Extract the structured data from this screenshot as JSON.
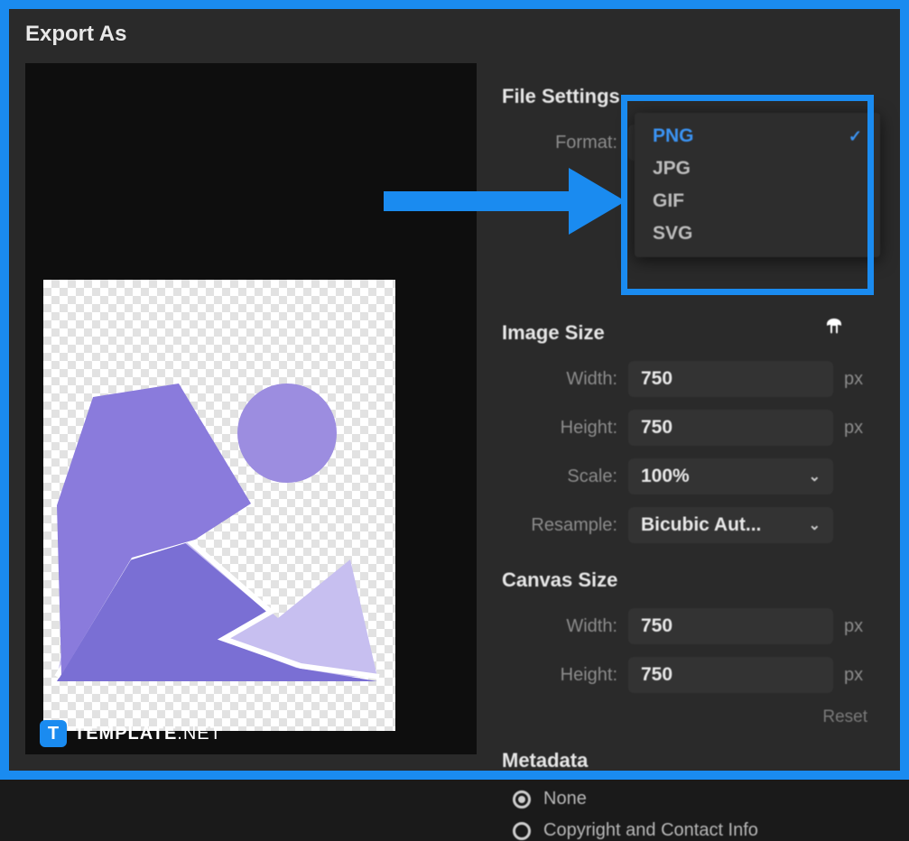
{
  "dialog": {
    "title": "Export As"
  },
  "fileSettings": {
    "header": "File Settings",
    "formatLabel": "Format:",
    "formatValue": "PNG",
    "options": [
      "PNG",
      "JPG",
      "GIF",
      "SVG"
    ]
  },
  "imageSize": {
    "header": "Image Size",
    "widthLabel": "Width:",
    "widthValue": "750",
    "heightLabel": "Height:",
    "heightValue": "750",
    "unit": "px",
    "scaleLabel": "Scale:",
    "scaleValue": "100%",
    "resampleLabel": "Resample:",
    "resampleValue": "Bicubic Aut..."
  },
  "canvasSize": {
    "header": "Canvas Size",
    "widthLabel": "Width:",
    "widthValue": "750",
    "heightLabel": "Height:",
    "heightValue": "750",
    "unit": "px",
    "resetLabel": "Reset"
  },
  "metadata": {
    "header": "Metadata",
    "option1": "None",
    "option2": "Copyright and Contact Info"
  },
  "watermark": {
    "badge": "T",
    "t1": "TEMPLATE",
    "t2": ".NET"
  }
}
